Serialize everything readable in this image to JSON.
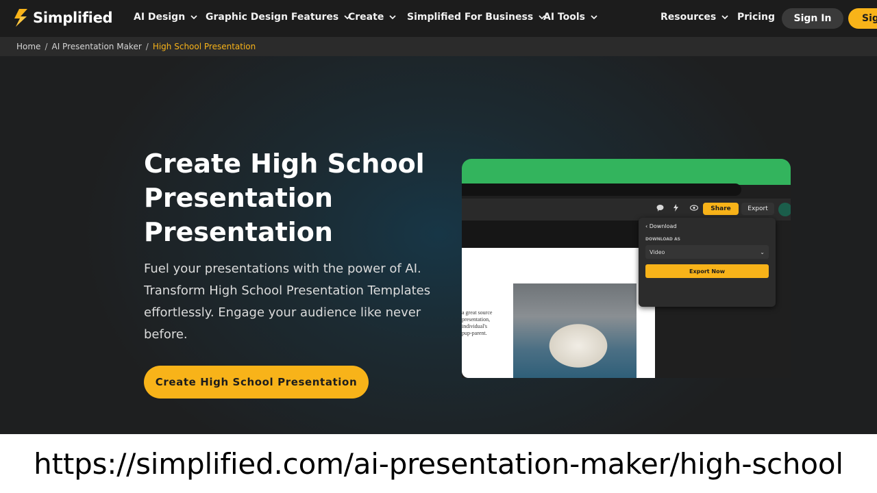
{
  "navbar": {
    "logo_text": "Simplified",
    "items": [
      {
        "label": "AI Design",
        "has_dropdown": true
      },
      {
        "label": "Graphic Design Features",
        "has_dropdown": true
      },
      {
        "label": "Create",
        "has_dropdown": true
      },
      {
        "label": "Simplified For Business",
        "has_dropdown": true
      },
      {
        "label": "AI Tools",
        "has_dropdown": true
      },
      {
        "label": "Resources",
        "has_dropdown": true
      },
      {
        "label": "Pricing",
        "has_dropdown": false
      }
    ],
    "sign_in_label": "Sign In",
    "sign_up_label": "Sig"
  },
  "breadcrumb": {
    "items": [
      "Home",
      "AI Presentation Maker"
    ],
    "current": "High School Presentation",
    "separator": "/"
  },
  "hero": {
    "title_lines": [
      "Create High School",
      "Presentation",
      "Presentation"
    ],
    "description": "Fuel your presentations with the power of AI. Transform High School Presentation Templates effortlessly. Engage your audience like never before.",
    "cta_label": "Create High School Presentation"
  },
  "mockup": {
    "share_label": "Share",
    "export_label": "Export",
    "download_label": "Download",
    "download_as_label": "DOWNLOAD AS",
    "format_value": "Video",
    "export_now_label": "Export Now",
    "slide_text": "a great source\npresentation,\nindividual's\npup-parent."
  },
  "caption": {
    "url": "https://simplified.com/ai-presentation-maker/high-school"
  },
  "colors": {
    "accent": "#f8b319",
    "nav_bg": "#1c1c1c",
    "breadcrumb_bg": "#2b2b2b",
    "mock_green": "#33b45d"
  }
}
